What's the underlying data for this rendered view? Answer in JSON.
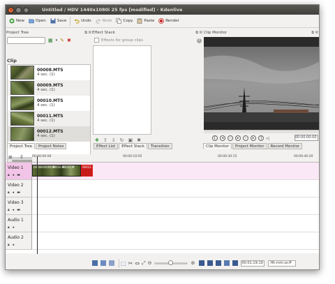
{
  "window": {
    "title": "Untitled / HDV 1440x1080i 25 fps [modified] - Kdenlive",
    "close": "×",
    "minimize": "–",
    "maximize": "□"
  },
  "toolbar": {
    "new": "New",
    "open": "Open",
    "save": "Save",
    "undo": "Undo",
    "redo": "Redo",
    "copy": "Copy",
    "paste": "Paste",
    "render": "Render"
  },
  "project_tree": {
    "title": "Project Tree",
    "header": "Clip",
    "clips": [
      {
        "name": "00008.MTS",
        "duration": "4 sec. (1)"
      },
      {
        "name": "00009.MTS",
        "duration": "4 sec. (1)"
      },
      {
        "name": "00010.MTS",
        "duration": "4 sec. (1)"
      },
      {
        "name": "00011.MTS",
        "duration": "4 sec. (1)"
      },
      {
        "name": "00012.MTS",
        "duration": "4 sec. (1)"
      }
    ],
    "tabs": [
      "Project Tree",
      "Project Notes"
    ]
  },
  "effect_stack": {
    "title": "Effect Stack",
    "checkbox_label": "Effects for group clips",
    "help": "?",
    "tabs": [
      "Effect List",
      "Effect Stack",
      "Transition"
    ]
  },
  "clip_monitor": {
    "title": "Clip Monitor",
    "timecode": "00:00:00:00",
    "tabs": [
      "Clip Monitor",
      "Project Monitor",
      "Record Monitor"
    ]
  },
  "timeline": {
    "ruler_labels": [
      "00:00:00:00",
      "00:00:10:05",
      "00:00:30:15",
      "00:00:40:20"
    ],
    "tracks": [
      {
        "name": "Video 1"
      },
      {
        "name": "Video 2"
      },
      {
        "name": "Video 3"
      },
      {
        "name": "Audio 1"
      },
      {
        "name": "Audio 2"
      }
    ],
    "clip_labels": [
      "00008",
      "00009.M",
      "00010.M",
      "00011.M",
      "00012.M"
    ]
  },
  "statusbar": {
    "timecode": "00:01:19:19",
    "mode": "Hh:mm:ss:ff"
  },
  "colors": {
    "titlebar": "#403f3b",
    "close_button": "#dd4814",
    "track_highlight": "#f2c5e8",
    "selected_clip": "#c81c1a"
  }
}
